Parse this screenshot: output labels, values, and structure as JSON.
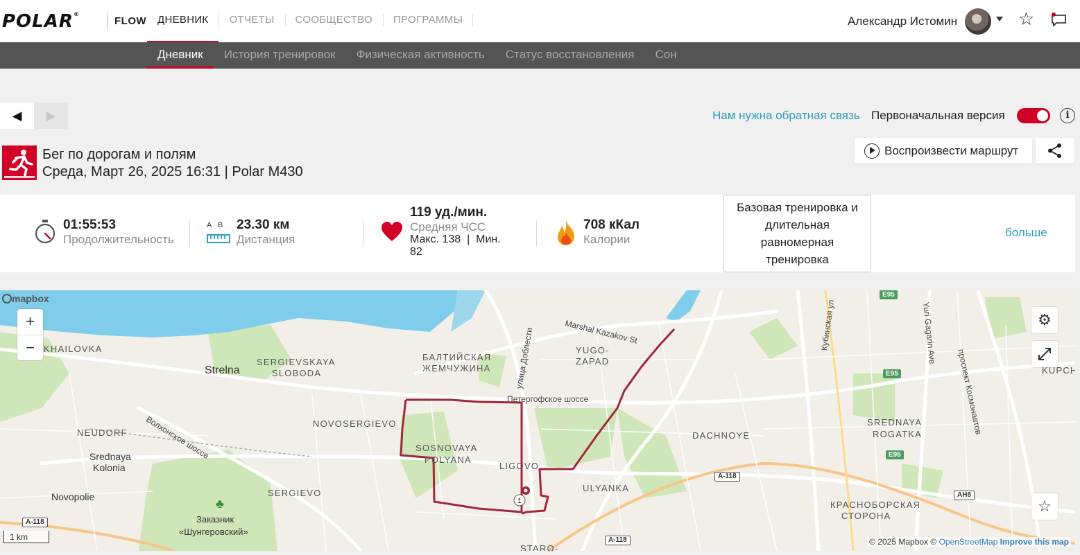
{
  "header": {
    "logo": "POLAR",
    "flow": "FLOW",
    "nav": [
      "ДНЕВНИК",
      "ОТЧЕТЫ",
      "СООБЩЕСТВО",
      "ПРОГРАММЫ"
    ],
    "user_name": "Александр Истомин"
  },
  "subnav": [
    "Дневник",
    "История тренировок",
    "Физическая активность",
    "Статус восстановления",
    "Сон"
  ],
  "toolbar": {
    "feedback_link": "Нам нужна обратная связь",
    "original_version_label": "Первоначальная версия",
    "original_version_on": true,
    "replay_label": "Воспроизвести маршрут"
  },
  "session": {
    "title": "Бег по дорогам и полям",
    "subtitle": "Среда, Март 26, 2025 16:31 | Polar M430"
  },
  "summary": {
    "duration_value": "01:55:53",
    "duration_label": "Продолжительность",
    "distance_ab": "A   B",
    "distance_value": "23.30 км",
    "distance_label": "Дистанция",
    "hr_value": "119 уд./мин.",
    "hr_label": "Средняя ЧСС",
    "hr_minmax_line1": "Макс. 138  |  Мин.",
    "hr_minmax_line2": "82",
    "calories_value": "708 кКал",
    "calories_label": "Калории",
    "training_type_lines": [
      "Базовая тренировка и",
      "длительная",
      "равномерная",
      "тренировка"
    ],
    "more_link": "больше"
  },
  "map": {
    "provider_logo": "mapbox",
    "zoom_in": "+",
    "zoom_out": "−",
    "scale": "1 km",
    "attribution": "© 2025 Mapbox ©",
    "attribution_osm": "OpenStreetMap",
    "improve": "Improve this map",
    "lap_marker": "1",
    "route_color": "#a0283d",
    "water_color": "#7fcdea",
    "labels": {
      "strelna": "Strelna",
      "sergievskaya1": "SERGIEVSKAYA",
      "sergievskaya2": "SLOBODA",
      "khailovka": "KHAILOVKA",
      "neudorf": "NEUDORF",
      "srednaya1": "Srednaya",
      "srednaya2": "Kolonia",
      "novopolie": "Novopolie",
      "novosergievo": "NOVOSERGIEVO",
      "sosnovaya1": "SOSNOVAYA",
      "sosnovaya2": "POLYANA",
      "sergievo": "SERGIEVO",
      "baltic1": "БАЛТИЙСКАЯ",
      "baltic2": "ЖЕМЧУЖИНА",
      "ligovo": "LIGOVO",
      "yugo1": "YUGO-",
      "yugo2": "ZAPAD",
      "marshal": "Marshal Kazakov St",
      "peterhof": "Петергофское шоссе",
      "dobl": "улица Доблести",
      "volkon": "Волхонское шоссе",
      "dachnoye": "DACHNOYE",
      "ulyanka": "ULYANKA",
      "srogatka1": "SREDNAYA",
      "srogatka2": "ROGATKA",
      "krasno1": "КРАСНОБОРСКАЯ",
      "krasno2": "СТОРОНА",
      "kubinskaya": "Кубинская ул",
      "gagarin": "Yuri Gagarin Ave",
      "kosmo": "проспект Космонавтов",
      "kupch": "KUPCH",
      "staro": "STARO-",
      "zakaznik1": "Заказник",
      "zakaznik2": "«Шунгеровский»",
      "a118a": "A-118",
      "a118b": "A-118",
      "a118c": "A-118",
      "ah8": "AH8",
      "e95a": "E95",
      "e95b": "E95",
      "e95c": "E95"
    }
  }
}
